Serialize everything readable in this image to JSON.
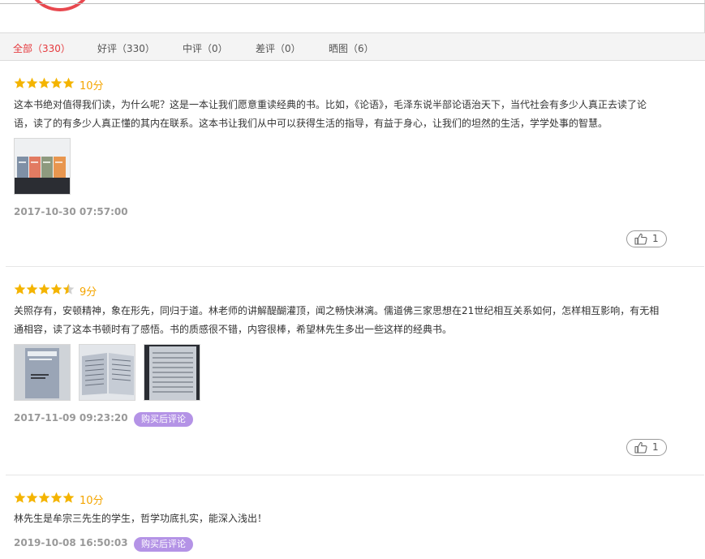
{
  "tabs": [
    {
      "label": "全部（330）",
      "active": true
    },
    {
      "label": "好评（330）",
      "active": false
    },
    {
      "label": "中评（0）",
      "active": false
    },
    {
      "label": "差评（0）",
      "active": false
    },
    {
      "label": "晒图（6）",
      "active": false
    }
  ],
  "reviews": [
    {
      "stars": 5,
      "score": "10分",
      "content": "这本书绝对值得我们读，为什么呢？这是一本让我们愿意重读经典的书。比如，《论语》，毛泽东说半部论语治天下，当代社会有多少人真正去读了论语，读了的有多少人真正懂的其内在联系。这本书让我们从中可以获得生活的指导，有益于身心，让我们的坦然的生活，学学处事的智慧。",
      "time": "2017-10-30 07:57:00",
      "likes": "1"
    },
    {
      "stars": 4.5,
      "score": "9分",
      "content": "关照存有，安顿精神，象在形先，同归于道。林老师的讲解醍醐灌顶，闻之畅快淋漓。儒道佛三家思想在21世纪相互关系如何，怎样相互影响，有无相通相容，读了这本书顿时有了感悟。书的质感很不错，内容很棒，希望林先生多出一些这样的经典书。",
      "time": "2017-11-09 09:23:20",
      "tag": "购买后评论",
      "likes": "1"
    },
    {
      "stars": 5,
      "score": "10分",
      "content": "林先生是牟宗三先生的学生，哲学功底扎实，能深入浅出！",
      "time": "2019-10-08 16:50:03",
      "tag": "购买后评论"
    }
  ],
  "colors": {
    "accent": "#e5393d",
    "star": "#f4b400",
    "score": "#f4a500",
    "tag_bg": "#b493e6"
  }
}
